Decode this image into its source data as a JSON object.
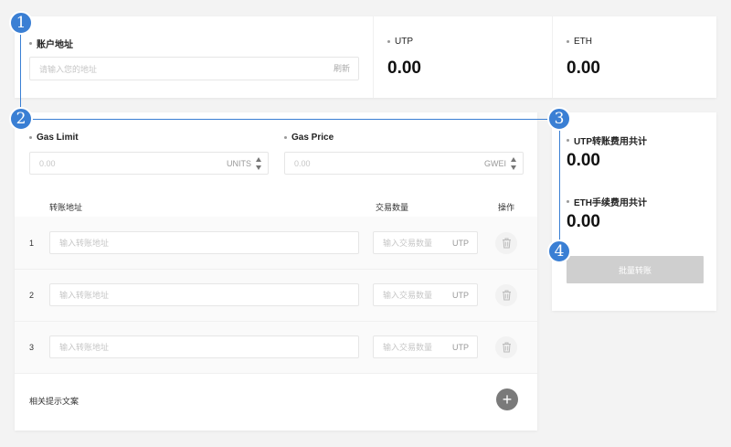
{
  "account": {
    "label": "账户地址",
    "placeholder": "请输入您的地址",
    "refresh": "刷新"
  },
  "balances": [
    {
      "label": "UTP",
      "value": "0.00"
    },
    {
      "label": "ETH",
      "value": "0.00"
    }
  ],
  "gas": {
    "limit_label": "Gas Limit",
    "limit_placeholder": "0.00",
    "limit_unit": "UNITS",
    "price_label": "Gas Price",
    "price_placeholder": "0.00",
    "price_unit": "GWEI"
  },
  "table": {
    "headers": {
      "address": "转账地址",
      "amount": "交易数量",
      "action": "操作"
    },
    "rows": [
      {
        "index": "1",
        "address_placeholder": "输入转账地址",
        "amount_placeholder": "输入交易数量",
        "unit": "UTP"
      },
      {
        "index": "2",
        "address_placeholder": "输入转账地址",
        "amount_placeholder": "输入交易数量",
        "unit": "UTP"
      },
      {
        "index": "3",
        "address_placeholder": "输入转账地址",
        "amount_placeholder": "输入交易数量",
        "unit": "UTP"
      }
    ],
    "footer_text": "相关提示文案"
  },
  "summary": {
    "utp_fee_label": "UTP转账费用共计",
    "utp_fee_value": "0.00",
    "eth_fee_label": "ETH手续费用共计",
    "eth_fee_value": "0.00",
    "batch_button": "批量转账"
  },
  "badges": [
    "1",
    "2",
    "3",
    "4"
  ],
  "colors": {
    "accent": "#3a7fd4",
    "button_disabled": "#cfcfcf"
  }
}
